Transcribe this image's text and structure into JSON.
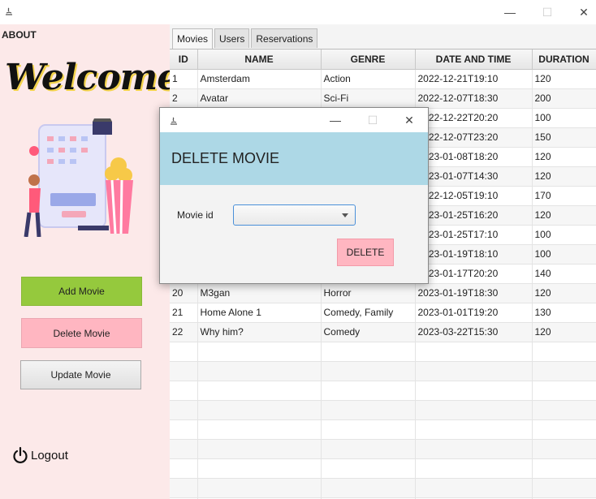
{
  "window": {
    "minimize": "—",
    "maximize": "☐",
    "close": "✕"
  },
  "sidebar": {
    "about": "ABOUT",
    "welcome": "Welcome!",
    "buttons": {
      "add": "Add Movie",
      "delete": "Delete Movie",
      "update": "Update Movie"
    },
    "logout": "Logout",
    "colors": {
      "background": "#fce9e9",
      "add": "#95c93d",
      "delete": "#ffb6c1",
      "update": "#e6e6e6"
    }
  },
  "tabs": [
    "Movies",
    "Users",
    "Reservations"
  ],
  "table": {
    "columns": [
      "ID",
      "NAME",
      "GENRE",
      "DATE AND TIME",
      "DURATION"
    ],
    "rows": [
      [
        "1",
        "Amsterdam",
        "Action",
        "2022-12-21T19:10",
        "120"
      ],
      [
        "2",
        "Avatar",
        "Sci-Fi",
        "2022-12-07T18:30",
        "200"
      ],
      [
        "",
        "",
        "",
        "2022-12-22T20:20",
        "100"
      ],
      [
        "",
        "",
        "",
        "2022-12-07T23:20",
        "150"
      ],
      [
        "",
        "",
        "",
        "2023-01-08T18:20",
        "120"
      ],
      [
        "",
        "",
        "",
        "2023-01-07T14:30",
        "120"
      ],
      [
        "",
        "",
        "",
        "2022-12-05T19:10",
        "170"
      ],
      [
        "",
        "",
        "",
        "2023-01-25T16:20",
        "120"
      ],
      [
        "",
        "",
        "",
        "2023-01-25T17:10",
        "100"
      ],
      [
        "",
        "",
        "",
        "2023-01-19T18:10",
        "100"
      ],
      [
        "",
        "",
        "",
        "2023-01-17T20:20",
        "140"
      ],
      [
        "20",
        "M3gan",
        "Horror",
        "2023-01-19T18:30",
        "120"
      ],
      [
        "21",
        "Home Alone 1",
        "Comedy, Family",
        "2023-01-01T19:20",
        "130"
      ],
      [
        "22",
        "Why him?",
        "Comedy",
        "2023-03-22T15:30",
        "120"
      ],
      [
        "",
        "",
        "",
        "",
        ""
      ],
      [
        "",
        "",
        "",
        "",
        ""
      ],
      [
        "",
        "",
        "",
        "",
        ""
      ],
      [
        "",
        "",
        "",
        "",
        ""
      ],
      [
        "",
        "",
        "",
        "",
        ""
      ],
      [
        "",
        "",
        "",
        "",
        ""
      ],
      [
        "",
        "",
        "",
        "",
        ""
      ],
      [
        "",
        "",
        "",
        "",
        ""
      ],
      [
        "",
        "",
        "",
        "",
        ""
      ]
    ]
  },
  "dialog": {
    "heading": "DELETE MOVIE",
    "field_label": "Movie id",
    "selected_value": "",
    "button": "DELETE",
    "colors": {
      "banner": "#add8e6",
      "button": "#ffb6c1"
    }
  }
}
